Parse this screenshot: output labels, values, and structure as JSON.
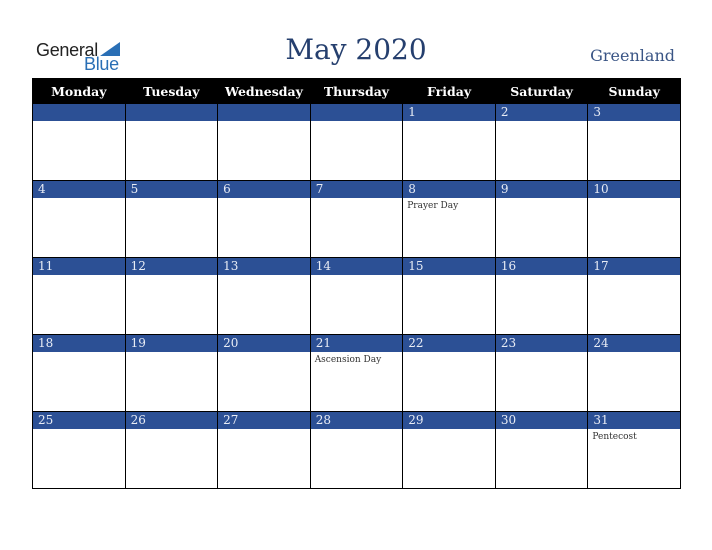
{
  "logo": {
    "line1": "General",
    "line2": "Blue"
  },
  "title": "May 2020",
  "region": "Greenland",
  "colors": {
    "header_bg": "#000000",
    "day_bar": "#2c5095",
    "title": "#253f6e"
  },
  "weekdays": [
    "Monday",
    "Tuesday",
    "Wednesday",
    "Thursday",
    "Friday",
    "Saturday",
    "Sunday"
  ],
  "weeks": [
    [
      {
        "d": "",
        "e": ""
      },
      {
        "d": "",
        "e": ""
      },
      {
        "d": "",
        "e": ""
      },
      {
        "d": "",
        "e": ""
      },
      {
        "d": "1",
        "e": ""
      },
      {
        "d": "2",
        "e": ""
      },
      {
        "d": "3",
        "e": ""
      }
    ],
    [
      {
        "d": "4",
        "e": ""
      },
      {
        "d": "5",
        "e": ""
      },
      {
        "d": "6",
        "e": ""
      },
      {
        "d": "7",
        "e": ""
      },
      {
        "d": "8",
        "e": "Prayer Day"
      },
      {
        "d": "9",
        "e": ""
      },
      {
        "d": "10",
        "e": ""
      }
    ],
    [
      {
        "d": "11",
        "e": ""
      },
      {
        "d": "12",
        "e": ""
      },
      {
        "d": "13",
        "e": ""
      },
      {
        "d": "14",
        "e": ""
      },
      {
        "d": "15",
        "e": ""
      },
      {
        "d": "16",
        "e": ""
      },
      {
        "d": "17",
        "e": ""
      }
    ],
    [
      {
        "d": "18",
        "e": ""
      },
      {
        "d": "19",
        "e": ""
      },
      {
        "d": "20",
        "e": ""
      },
      {
        "d": "21",
        "e": "Ascension Day"
      },
      {
        "d": "22",
        "e": ""
      },
      {
        "d": "23",
        "e": ""
      },
      {
        "d": "24",
        "e": ""
      }
    ],
    [
      {
        "d": "25",
        "e": ""
      },
      {
        "d": "26",
        "e": ""
      },
      {
        "d": "27",
        "e": ""
      },
      {
        "d": "28",
        "e": ""
      },
      {
        "d": "29",
        "e": ""
      },
      {
        "d": "30",
        "e": ""
      },
      {
        "d": "31",
        "e": "Pentecost"
      }
    ]
  ]
}
